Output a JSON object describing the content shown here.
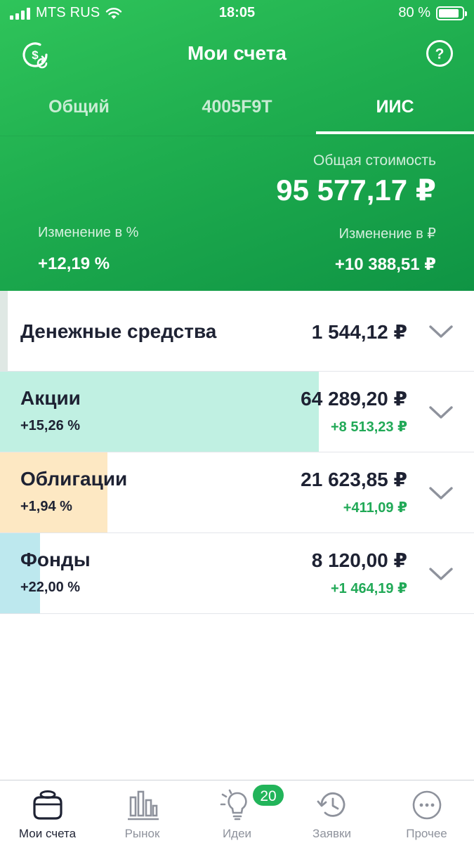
{
  "status_bar": {
    "carrier": "MTS RUS",
    "time": "18:05",
    "battery": "80 %"
  },
  "nav": {
    "title": "Мои счета",
    "left_icon": "dollar-refresh-icon",
    "right_icon": "help-icon"
  },
  "tabs": [
    {
      "label": "Общий",
      "active": false
    },
    {
      "label": "4005F9T",
      "active": false
    },
    {
      "label": "ИИС",
      "active": true
    }
  ],
  "summary": {
    "total_label": "Общая стоимость",
    "total_value": "95 577,17 ₽",
    "change_pct_label": "Изменение в %",
    "change_pct_value": "+12,19 %",
    "change_rub_label": "Изменение в ₽",
    "change_rub_value": "+10 388,51 ₽"
  },
  "assets": [
    {
      "name": "Денежные средства",
      "amount": "1 544,12 ₽",
      "pct": "",
      "delta": "",
      "share": 0.016,
      "color": "#dfe8e4"
    },
    {
      "name": "Акции",
      "amount": "64 289,20 ₽",
      "pct": "+15,26 %",
      "delta": "+8 513,23 ₽",
      "share": 0.673,
      "color": "#c0f0e2"
    },
    {
      "name": "Облигации",
      "amount": "21 623,85 ₽",
      "pct": "+1,94 %",
      "delta": "+411,09 ₽",
      "share": 0.226,
      "color": "#fde8c3"
    },
    {
      "name": "Фонды",
      "amount": "8 120,00 ₽",
      "pct": "+22,00 %",
      "delta": "+1 464,19 ₽",
      "share": 0.085,
      "color": "#bde8ee"
    }
  ],
  "tabbar": [
    {
      "label": "Мои счета",
      "icon": "wallet-icon",
      "active": true
    },
    {
      "label": "Рынок",
      "icon": "market-chart-icon",
      "active": false
    },
    {
      "label": "Идеи",
      "icon": "lightbulb-icon",
      "active": false,
      "badge": "20"
    },
    {
      "label": "Заявки",
      "icon": "history-clock-icon",
      "active": false
    },
    {
      "label": "Прочее",
      "icon": "more-dots-icon",
      "active": false
    }
  ],
  "colors": {
    "header_green": "#1fae4f",
    "positive": "#21a957",
    "text_dark": "#1e2233",
    "badge": "#22b45a"
  }
}
